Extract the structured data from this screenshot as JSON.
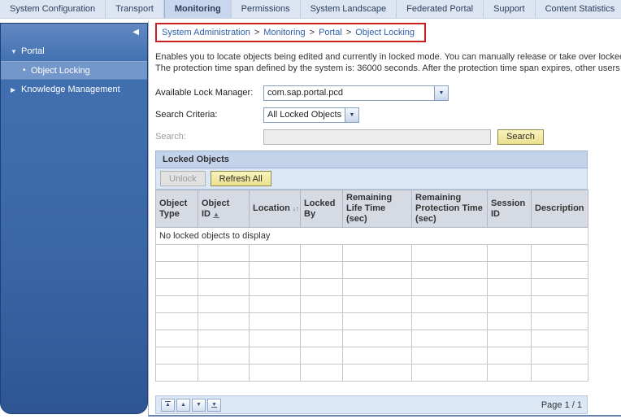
{
  "tabs": [
    {
      "label": "System Configuration"
    },
    {
      "label": "Transport"
    },
    {
      "label": "Monitoring",
      "active": true
    },
    {
      "label": "Permissions"
    },
    {
      "label": "System Landscape"
    },
    {
      "label": "Federated Portal"
    },
    {
      "label": "Support"
    },
    {
      "label": "Content Statistics"
    }
  ],
  "breadcrumb": {
    "separator": ">",
    "items": [
      "System Administration",
      "Monitoring",
      "Portal",
      "Object Locking"
    ]
  },
  "sidebar": {
    "items": [
      {
        "label": "Portal",
        "state": "expanded"
      },
      {
        "label": "Object Locking",
        "state": "selected"
      },
      {
        "label": "Knowledge Management",
        "state": "collapsed"
      }
    ]
  },
  "main": {
    "description_line1": "Enables you to locate objects being edited and currently in locked mode. You can manually release or take over locked",
    "description_line2": "The protection time span defined by the system is: 36000 seconds. After the protection time span expires, other users",
    "form": {
      "lock_manager_label": "Available Lock Manager:",
      "lock_manager_value": "com.sap.portal.pcd",
      "search_criteria_label": "Search Criteria:",
      "search_criteria_value": "All Locked Objects",
      "search_label": "Search:",
      "search_value": "",
      "search_button_label": "Search"
    },
    "table": {
      "title": "Locked Objects",
      "unlock_button_label": "Unlock",
      "refresh_button_label": "Refresh All",
      "columns": [
        {
          "label": "Object Type"
        },
        {
          "label": "Object ID",
          "sort": "ascending"
        },
        {
          "label": "Location",
          "sort": "both"
        },
        {
          "label": "Locked By"
        },
        {
          "label": "Remaining Life Time (sec)"
        },
        {
          "label": "Remaining Protection Time (sec)"
        },
        {
          "label": "Session ID"
        },
        {
          "label": "Description"
        }
      ],
      "empty_message": "No locked objects to display",
      "empty_row_count": 8,
      "page_label": "Page 1 / 1"
    }
  },
  "icons": {
    "collapse_left": "◀",
    "expanded_triangle": "▼",
    "collapsed_triangle": "▶",
    "bullet": "•",
    "dropdown_arrow": "▼",
    "sort_ascending": "▲",
    "sort_both": "↓↑",
    "page_first": "▲",
    "page_prev": "▲",
    "page_next": "▼",
    "page_last": "▼"
  },
  "colors": {
    "annotation_red": "#cc1f1f",
    "accent_yellow_button": "#f0e49a",
    "sidebar_blue": "#3a66a6",
    "panel_header_blue": "#c2d3ea",
    "toolbar_blue": "#dce7f5",
    "tab_bar": "#dde5f3"
  }
}
